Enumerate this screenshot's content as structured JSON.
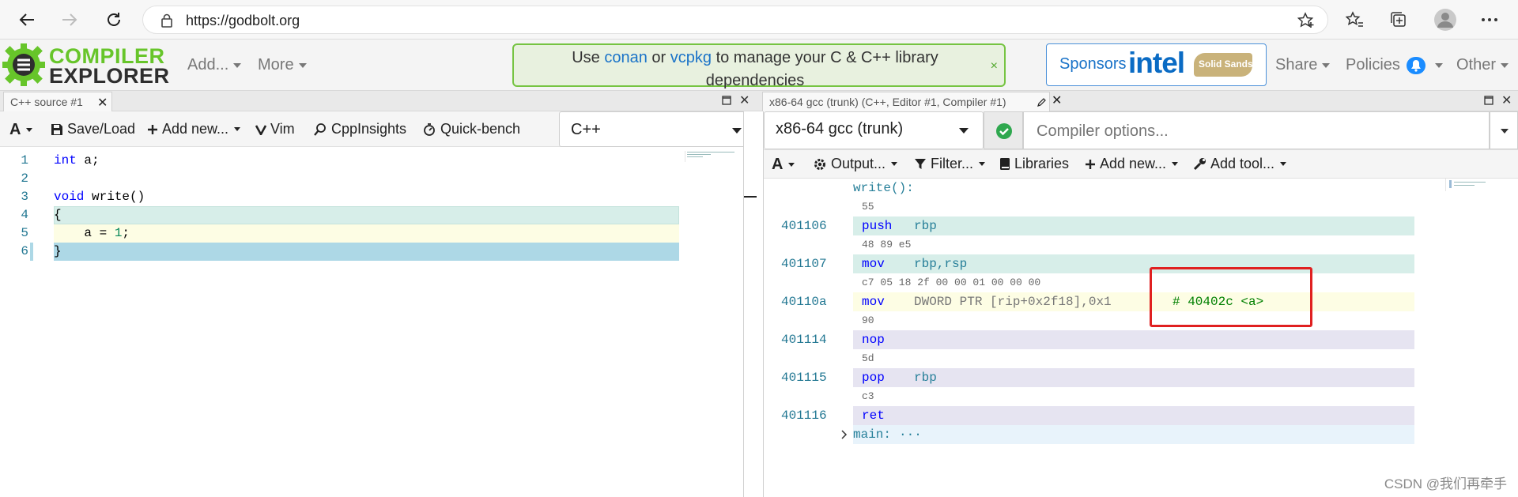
{
  "browser": {
    "url": "https://godbolt.org"
  },
  "header": {
    "logo_line1": "COMPILER",
    "logo_line2": "EXPLORER",
    "menu": [
      {
        "label": "Add..."
      },
      {
        "label": "More"
      }
    ],
    "banner": {
      "prefix": "Use",
      "link1": "conan",
      "middle": "or",
      "link2": "vcpkg",
      "suffix": "to manage your C & C++ library dependencies",
      "close": "×"
    },
    "sponsors_label": "Sponsors",
    "sponsor_intel": "intel",
    "sponsor_solid": "Solid Sands",
    "right_menu": [
      {
        "label": "Share"
      },
      {
        "label": "Policies"
      },
      {
        "label": "Other"
      }
    ]
  },
  "source_pane": {
    "tab_title": "C++ source #1",
    "toolbar": {
      "font_btn": "A",
      "save_load": "Save/Load",
      "add_new": "Add new...",
      "vim": "Vim",
      "cppinsights": "CppInsights",
      "quickbench": "Quick-bench",
      "language": "C++"
    },
    "lines": [
      {
        "num": "1",
        "code": "int a;"
      },
      {
        "num": "2",
        "code": ""
      },
      {
        "num": "3",
        "code": "void write()"
      },
      {
        "num": "4",
        "code": "{"
      },
      {
        "num": "5",
        "code": "    a = 1;"
      },
      {
        "num": "6",
        "code": "}"
      }
    ]
  },
  "compiler_pane": {
    "tab_title": "x86-64 gcc (trunk) (C++, Editor #1, Compiler #1)",
    "compiler": "x86-64 gcc (trunk)",
    "options_placeholder": "Compiler options...",
    "toolbar": {
      "font_btn": "A",
      "output": "Output...",
      "filter": "Filter...",
      "libraries": "Libraries",
      "add_new": "Add new...",
      "add_tool": "Add tool..."
    },
    "asm": {
      "label": "write():",
      "rows": [
        {
          "bytes": "55",
          "addr": "401106",
          "op": "push",
          "args": "rbp"
        },
        {
          "bytes": "48 89 e5",
          "addr": "401107",
          "op": "mov",
          "args": "rbp,rsp"
        },
        {
          "bytes": "c7 05 18 2f 00 00 01 00 00 00",
          "addr": "40110a",
          "op": "mov",
          "args": "DWORD PTR [rip+0x2f18],0x1",
          "comment": "# 40402c <a>"
        },
        {
          "bytes": "90",
          "addr": "401114",
          "op": "nop",
          "args": ""
        },
        {
          "bytes": "5d",
          "addr": "401115",
          "op": "pop",
          "args": "rbp"
        },
        {
          "bytes": "c3",
          "addr": "401116",
          "op": "ret",
          "args": ""
        }
      ],
      "main_label": "main:",
      "main_ellipsis": "···"
    }
  },
  "watermark": "CSDN @我们再牵手",
  "colors": {
    "brand_green": "#67c52a",
    "link_blue": "#1a73c8",
    "highlight_red": "#e02020"
  }
}
